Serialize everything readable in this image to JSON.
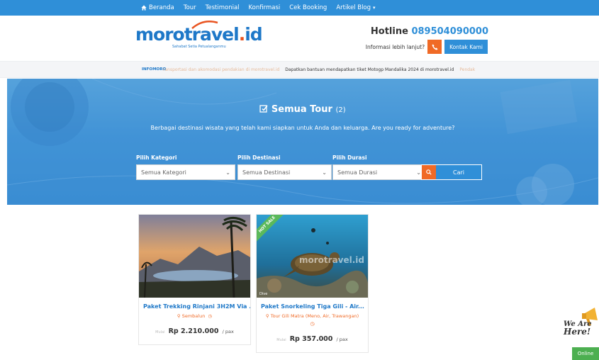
{
  "nav": {
    "items": [
      {
        "label": "Beranda"
      },
      {
        "label": "Tour"
      },
      {
        "label": "Testimonial"
      },
      {
        "label": "Konfirmasi"
      },
      {
        "label": "Cek Booking"
      },
      {
        "label": "Artikel Blog"
      }
    ]
  },
  "header": {
    "logo_moro": "moro",
    "logo_travel": "travel",
    "logo_dot": ".",
    "logo_id": "id",
    "tagline": "Sahabat Setia Petualanganmu",
    "hotline_label": "Hotline",
    "hotline_number": "089504090000",
    "info_text": "Informasi lebih lanjut?",
    "contact_label": "Kontak Kami"
  },
  "ticker": {
    "label": "INFOMORO",
    "messages": [
      "ransportasi dan akomodasi pendakian di morotravel.id",
      "Dapatkan bantuan mendapatkan tiket Motogp Mandalika 2024 di morotravel.id",
      "Pendak"
    ]
  },
  "hero": {
    "title": "Semua Tour",
    "count": "(2)",
    "subtitle": "Berbagai destinasi wisata yang telah kami siapkan untuk Anda dan keluarga. Are you ready for adventure?",
    "filters": [
      {
        "label": "Pilih Kategori",
        "value": "Semua Kategori"
      },
      {
        "label": "Pilih Destinasi",
        "value": "Semua Destinasi"
      },
      {
        "label": "Pilih Durasi",
        "value": "Semua Durasi"
      }
    ],
    "search_label": "Cari"
  },
  "tours": [
    {
      "title": "Paket Trekking Rinjani 3H2M Via ...",
      "location": "Sembalun",
      "price_prefix": "Mulai",
      "price": "Rp 2.210.000",
      "unit": "/ pax",
      "badge": ""
    },
    {
      "title": "Paket Snorkeling Tiga Gili - Air...",
      "location": "Tour Gili Matra (Meno, Air, Trawangan)",
      "price_prefix": "Mulai",
      "price": "Rp 357.000",
      "unit": "/ pax",
      "badge": "HOT SALE",
      "watermark": "morotravel.id",
      "caption": "Dive"
    }
  ],
  "widget": {
    "line1": "We Are",
    "line2": "Here!",
    "status": "Online"
  },
  "colors": {
    "primary": "#2f8fd8",
    "accent": "#f06a26",
    "badge": "#5bb95b",
    "online": "#4caf50"
  }
}
